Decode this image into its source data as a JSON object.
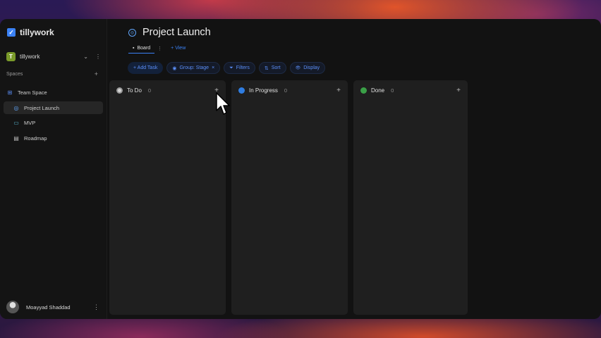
{
  "brand": {
    "name": "tillywork",
    "logo_icon": "check-square-icon",
    "accent": "#3b82f6"
  },
  "workspace": {
    "initial": "T",
    "name": "tillywork",
    "chevron": "⌄",
    "more": "⋮"
  },
  "spaces": {
    "label": "Spaces",
    "add": "+"
  },
  "nav": [
    {
      "label": "Team Space",
      "icon": "⊞"
    },
    {
      "label": "Project Launch",
      "icon": "◎"
    },
    {
      "label": "MVP",
      "icon": "▭"
    },
    {
      "label": "Roadmap",
      "icon": "▤"
    }
  ],
  "user": {
    "name": "Moayyad Shaddad",
    "more": "⋮"
  },
  "page": {
    "title": "Project Launch",
    "title_icon": "◎"
  },
  "view_tabs": {
    "active": "Board",
    "active_icon": "▪",
    "sep": "⋮",
    "add": "+ View"
  },
  "toolbar": {
    "add_task": "+ Add Task",
    "group": "Group: Stage",
    "group_icon": "◉",
    "group_clear": "×",
    "filters": "Filters",
    "filters_icon": "⏷",
    "sort": "Sort",
    "sort_icon": "⇅",
    "display": "Display",
    "display_icon": "👁"
  },
  "columns": [
    {
      "title": "To Do",
      "count": "0",
      "add": "+",
      "color": "#d4d4d4"
    },
    {
      "title": "In Progress",
      "count": "0",
      "add": "+",
      "color": "#2f7de1"
    },
    {
      "title": "Done",
      "count": "0",
      "add": "+",
      "color": "#3aa047"
    }
  ]
}
